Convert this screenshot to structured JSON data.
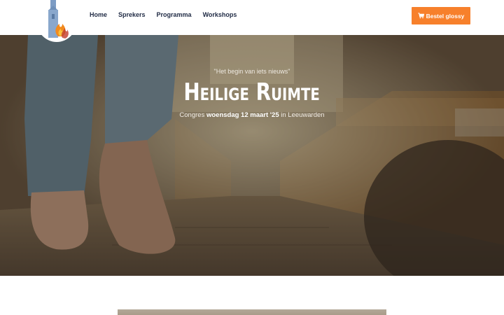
{
  "nav": {
    "items": [
      {
        "label": "Home"
      },
      {
        "label": "Sprekers"
      },
      {
        "label": "Programma"
      },
      {
        "label": "Workshops"
      }
    ]
  },
  "cta": {
    "label": "Bestel glossy",
    "icon": "cart-icon",
    "color": "#f7802b"
  },
  "hero": {
    "quote": "\"Het begin van iets nieuws\"",
    "title": "Heilige Ruimte",
    "subtitle_prefix": "Congres ",
    "subtitle_date": "woensdag 12 maart '25",
    "subtitle_suffix": " in Leeuwarden"
  },
  "logo": {
    "icon": "church-flame-logo"
  }
}
